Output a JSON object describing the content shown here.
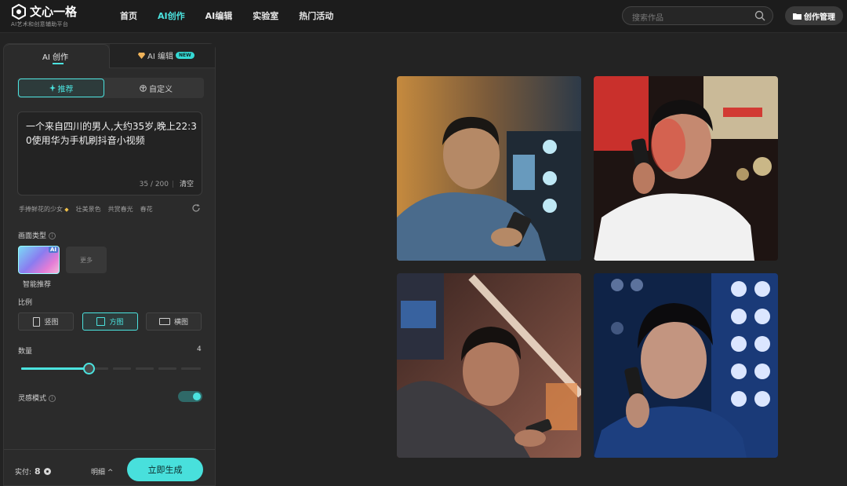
{
  "app": {
    "brand_name": "文心一格",
    "brand_tagline": "AI艺术和创意辅助平台"
  },
  "nav": {
    "items": [
      {
        "label": "首页",
        "active": false
      },
      {
        "label": "AI创作",
        "active": true
      },
      {
        "label": "AI编辑",
        "active": false
      },
      {
        "label": "实验室",
        "active": false
      },
      {
        "label": "热门活动",
        "active": false
      }
    ]
  },
  "search": {
    "placeholder": "搜索作品",
    "icon": "search-icon"
  },
  "manage_button": {
    "label": "创作管理",
    "icon": "folder-icon"
  },
  "panel": {
    "tabs": [
      {
        "label": "AI 创作",
        "active": true
      },
      {
        "label": "AI 编辑",
        "badge": "NEW",
        "icon": "gem-icon"
      }
    ],
    "mode": {
      "recommend": "推荐",
      "custom": "自定义"
    },
    "prompt": {
      "text": "一个来自四川的男人,大约35岁,晚上22:30使用华为手机刷抖音小视频",
      "count": "35 / 200",
      "separator": "|",
      "clear": "清空"
    },
    "suggestions": [
      "手捧鲜花的少女",
      "壮美景色",
      "共赏春光",
      "春花"
    ],
    "style_section": {
      "label": "画面类型",
      "selected_label": "智能推荐",
      "badge": "AI",
      "more": "更多"
    },
    "ratio_section": {
      "label": "比例",
      "options": [
        {
          "label": "竖图",
          "active": false
        },
        {
          "label": "方图",
          "active": true
        },
        {
          "label": "横图",
          "active": false
        }
      ]
    },
    "quantity_section": {
      "label": "数量",
      "value": "4",
      "level": 0.375
    },
    "inspiration": {
      "label": "灵感模式",
      "enabled": true
    },
    "footer": {
      "cost_label": "实付:",
      "cost_value": "8",
      "detail": "明细 ^",
      "generate": "立即生成"
    }
  },
  "colors": {
    "accent": "#4be3df",
    "background": "#232323",
    "panel": "#2b2b2b"
  }
}
